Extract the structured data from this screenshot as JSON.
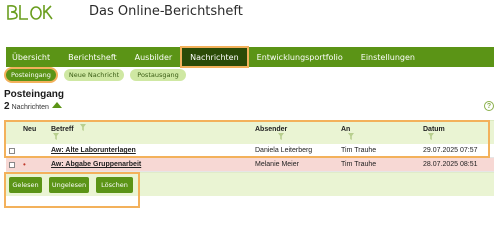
{
  "app": {
    "logo_text": "BLoK",
    "title": "Das Online-Berichtsheft"
  },
  "nav": [
    {
      "label": "Übersicht",
      "active": false
    },
    {
      "label": "Berichtsheft",
      "active": false
    },
    {
      "label": "Ausbilder",
      "active": false
    },
    {
      "label": "Nachrichten",
      "active": true
    },
    {
      "label": "Entwicklungsportfolio",
      "active": false
    },
    {
      "label": "Einstellungen",
      "active": false
    }
  ],
  "subnav": [
    {
      "label": "Posteingang",
      "active": true
    },
    {
      "label": "Neue Nachricht",
      "active": false
    },
    {
      "label": "Postausgang",
      "active": false
    }
  ],
  "section": {
    "title": "Posteingang",
    "count": "2",
    "count_label": "Nachrichten"
  },
  "help": {
    "label": "?"
  },
  "table": {
    "headers": {
      "new": "Neu",
      "subject": "Betreff",
      "sender": "Absender",
      "to": "An",
      "date": "Datum"
    },
    "rows": [
      {
        "new": "",
        "subject": "Aw: Alte Laborunterlagen",
        "sender": "Daniela Leiterberg",
        "to": "Tim Trauhe",
        "date": "29.07.2025 07:57"
      },
      {
        "new": "•",
        "subject": "Aw: Abgabe Gruppenarbeit",
        "sender": "Melanie Meier",
        "to": "Tim Trauhe",
        "date": "28.07.2025 08:51"
      }
    ]
  },
  "actions": {
    "read": "Gelesen",
    "unread": "Ungelesen",
    "delete": "Löschen"
  },
  "colors": {
    "primary": "#5b9416",
    "nav_active": "#2b4b07",
    "highlight": "#f3b15b",
    "pill": "#cfe8a3",
    "header_bg": "#eaf4d3",
    "unread_row": "#f7d8d4"
  }
}
